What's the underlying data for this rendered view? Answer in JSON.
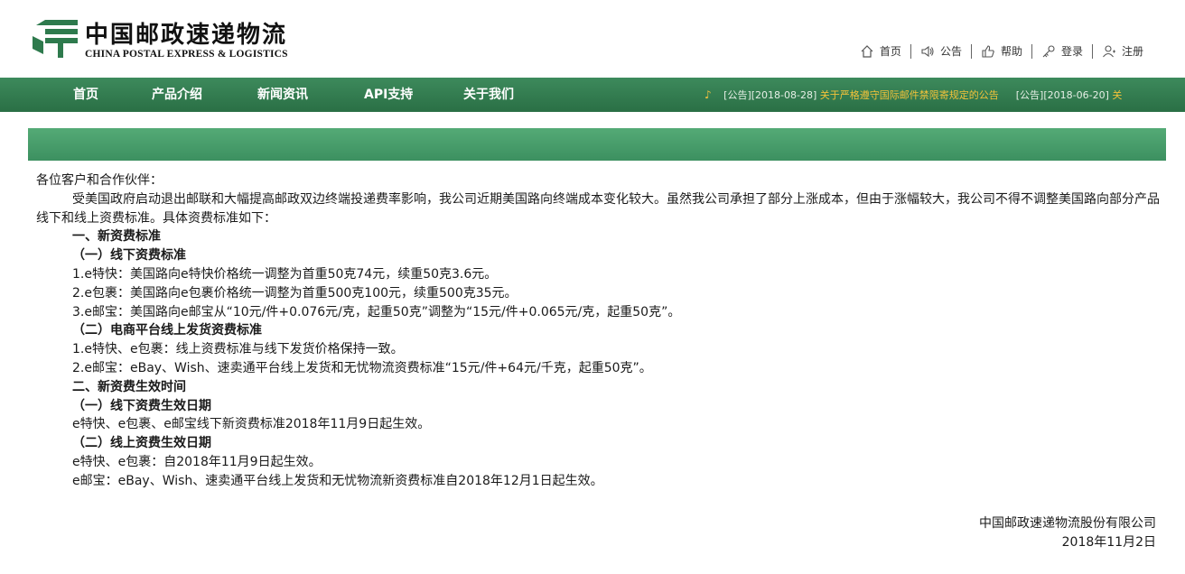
{
  "brand": {
    "name_cn": "中国邮政速递物流",
    "name_en": "CHINA POSTAL EXPRESS & LOGISTICS",
    "green": "#2e7a4d"
  },
  "toplinks": [
    {
      "label": "首页",
      "icon": "home-icon"
    },
    {
      "label": "公告",
      "icon": "speaker-icon"
    },
    {
      "label": "帮助",
      "icon": "thumb-icon"
    },
    {
      "label": "登录",
      "icon": "key-icon"
    },
    {
      "label": "注册",
      "icon": "user-icon"
    }
  ],
  "nav": {
    "items": [
      "首页",
      "产品介绍",
      "新闻资讯",
      "API支持",
      "关于我们"
    ],
    "notices": [
      {
        "tag": "[公告][2018-08-28]",
        "title": "关于严格遵守国际邮件禁限寄规定的公告"
      },
      {
        "tag": "[公告][2018-06-20]",
        "title": "关"
      }
    ]
  },
  "article": {
    "salutation": "各位客户和合作伙伴：",
    "intro": "受美国政府启动退出邮联和大幅提高邮政双边终端投递费率影响，我公司近期美国路向终端成本变化较大。虽然我公司承担了部分上涨成本，但由于涨幅较大，我公司不得不调整美国路向部分产品线下和线上资费标准。具体资费标准如下：",
    "s1": "一、新资费标准",
    "s1_1": "（一）线下资费标准",
    "s1_1_items": [
      "1.e特快：美国路向e特快价格统一调整为首重50克74元，续重50克3.6元。",
      "2.e包裹：美国路向e包裹价格统一调整为首重500克100元，续重500克35元。",
      "3.e邮宝：美国路向e邮宝从“10元/件+0.076元/克，起重50克”调整为“15元/件+0.065元/克，起重50克”。"
    ],
    "s1_2": "（二）电商平台线上发货资费标准",
    "s1_2_items": [
      "1.e特快、e包裹：线上资费标准与线下发货价格保持一致。",
      "2.e邮宝：eBay、Wish、速卖通平台线上发货和无忧物流资费标准“15元/件+64元/千克，起重50克”。"
    ],
    "s2": "二、新资费生效时间",
    "s2_1": "（一）线下资费生效日期",
    "s2_1_items": [
      "e特快、e包裹、e邮宝线下新资费标准2018年11月9日起生效。"
    ],
    "s2_2": "（二）线上资费生效日期",
    "s2_2_items": [
      "e特快、e包裹：自2018年11月9日起生效。",
      "e邮宝：eBay、Wish、速卖通平台线上发货和无忧物流新资费标准自2018年12月1日起生效。"
    ],
    "signature_org": "中国邮政速递物流股份有限公司",
    "signature_date": "2018年11月2日"
  }
}
